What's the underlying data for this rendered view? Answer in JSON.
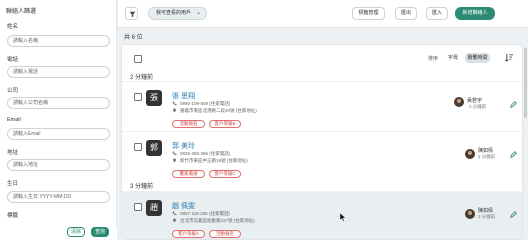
{
  "sidebar": {
    "title": "聯絡人篩選",
    "fields": [
      {
        "label": "姓名",
        "placeholder": "請輸入名稱"
      },
      {
        "label": "電話",
        "placeholder": "請輸入電話"
      },
      {
        "label": "公司",
        "placeholder": "請輸入公司名稱"
      },
      {
        "label": "Email",
        "placeholder": "請輸入Email"
      },
      {
        "label": "地址",
        "placeholder": "請輸入地址"
      },
      {
        "label": "生日",
        "placeholder": "請輸入生日 YYYY-MM-DD"
      },
      {
        "label": "標籤",
        "placeholder": ""
      }
    ],
    "clear_label": "清除",
    "search_label": "查詢"
  },
  "toolbar": {
    "owner_filter": "我可查看的用戶",
    "tag_manage": "標籤管理",
    "export": "匯出",
    "import": "匯入",
    "add_contact": "新增聯絡人"
  },
  "list": {
    "count_text": "共 6 位",
    "sort_label": "排序",
    "sort_options": [
      "字母",
      "聯繫時間"
    ],
    "active_sort": "聯繫時間",
    "groups": [
      {
        "label": "2 分鐘前"
      },
      {
        "label": "3 分鐘前"
      }
    ],
    "contacts": [
      {
        "initial": "張",
        "name": "張 思翔",
        "phone": "0990-109-809 (住家電話)",
        "address": "嘉義市東區北港路二段20號 (住家地址)",
        "tags": [
          "活動報名",
          "客戶等級B"
        ],
        "owner": "黃若宇",
        "time": "2 分鐘前"
      },
      {
        "initial": "郭",
        "name": "郭 美玲",
        "phone": "0925-386-386 (住家電話)",
        "address": "新竹市東區中正路18號 (住家地址)",
        "tags": [
          "畫家邀請",
          "客戶等級C"
        ],
        "owner": "陳如倩",
        "time": "2 分鐘前"
      },
      {
        "initial": "趙",
        "name": "趙 佩雯",
        "phone": "0957-118-338 (住家電話)",
        "address": "台北市信義區松勤路237號 (住家地址)",
        "tags": [
          "客戶等級A",
          "活動報名"
        ],
        "owner": "陳如倩",
        "time": "3 分鐘前"
      }
    ]
  },
  "colors": {
    "accent": "#2e8b73",
    "link": "#2a7ab0",
    "tag_red": "#d04040",
    "hover_row": "#e9eff1"
  }
}
